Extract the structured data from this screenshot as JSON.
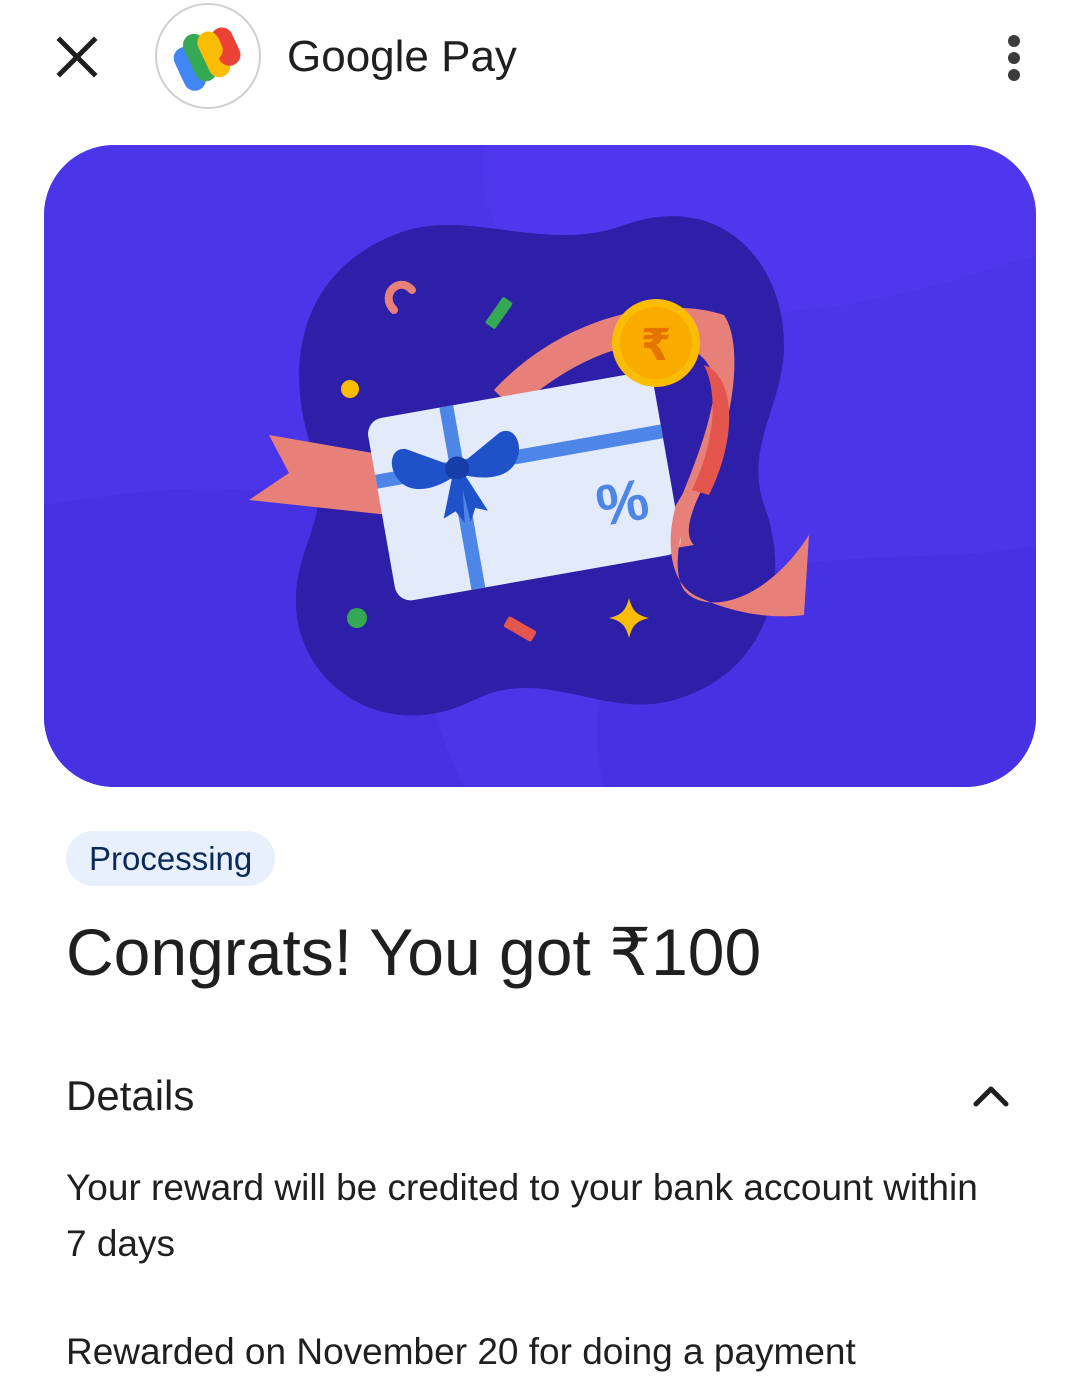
{
  "header": {
    "title": "Google Pay",
    "close_icon": "close-icon",
    "logo_icon": "google-pay-logo",
    "more_icon": "more-vertical-icon"
  },
  "hero": {
    "illustration": "gift-card-reward",
    "background_color": "#4b35e8",
    "card_symbol": "%",
    "coin_symbol": "₹"
  },
  "reward": {
    "status": "Processing",
    "headline": "Congrats! You got ₹100"
  },
  "details": {
    "title": "Details",
    "toggle_icon": "chevron-up-icon",
    "credit_note": "Your reward will be credited to your bank account within 7 days",
    "reward_note": "Rewarded on November 20 for doing a payment"
  }
}
